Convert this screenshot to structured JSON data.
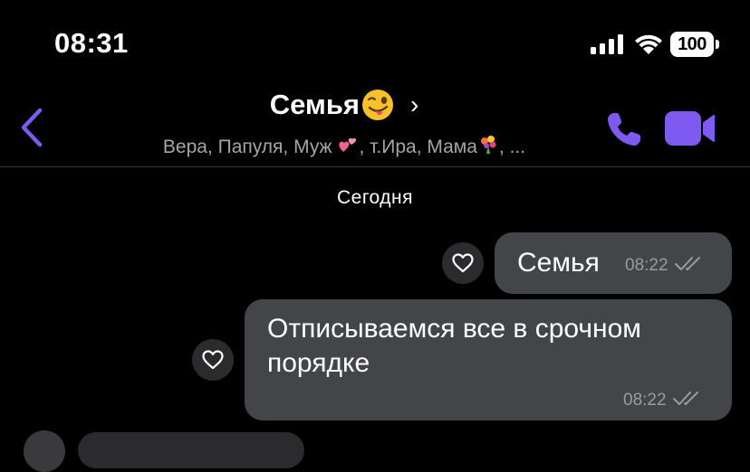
{
  "status_bar": {
    "time": "08:31",
    "battery": "100",
    "icons": [
      "signal-icon",
      "wifi-icon",
      "battery-icon"
    ]
  },
  "header": {
    "title": "Семья",
    "title_emoji": "winking-face-with-tongue",
    "members": "Вера, Папуля, Муж",
    "members_part2": ", т.Ира, Мама",
    "members_part3": ", ...",
    "accent_color": "#7f5af0"
  },
  "date_separator": "Сегодня",
  "messages": [
    {
      "text": "Семья",
      "time": "08:22",
      "status": "read"
    },
    {
      "text": "Отписываемся все в срочном порядке",
      "time": "08:22",
      "status": "read"
    }
  ]
}
